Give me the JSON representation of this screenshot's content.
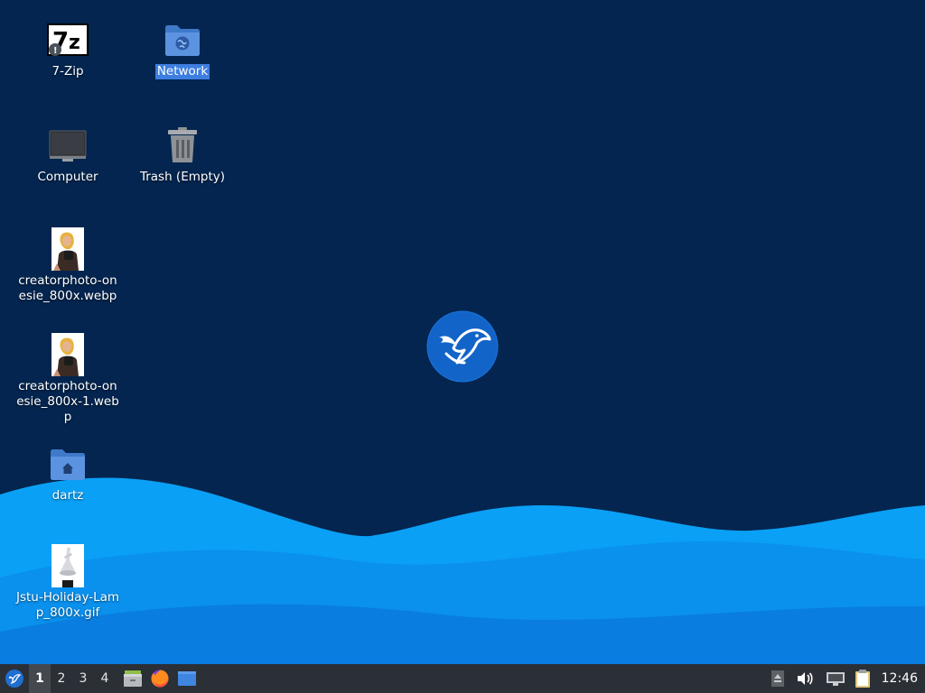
{
  "desktop": {
    "icons": {
      "sevenzip": {
        "label": "7-Zip"
      },
      "network": {
        "label": "Network"
      },
      "computer": {
        "label": "Computer"
      },
      "trash": {
        "label": "Trash (Empty)"
      },
      "photo1": {
        "label": "creatorphoto-onesie_800x.webp"
      },
      "photo2": {
        "label": "creatorphoto-onesie_800x-1.webp"
      },
      "home": {
        "label": "dartz"
      },
      "lamp": {
        "label": "Jstu-Holiday-Lamp_800x.gif"
      }
    }
  },
  "taskbar": {
    "workspaces": [
      "1",
      "2",
      "3",
      "4"
    ],
    "active_workspace": "1",
    "clock": "12:46"
  },
  "colors": {
    "wallpaper_dark": "#03254f",
    "wave_light": "#0aa0f5",
    "wave_mid": "#0b84e6",
    "taskbar": "#2b2f36",
    "selection": "#3d7ee0",
    "folder": "#4a86d8"
  }
}
